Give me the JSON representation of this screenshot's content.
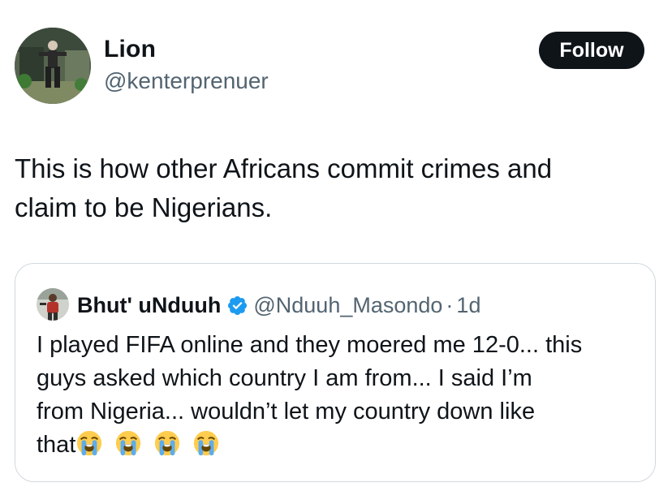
{
  "author": {
    "display_name": "Lion",
    "handle": "@kenterprenuer",
    "avatar_icon": "profile-photo"
  },
  "follow_button": {
    "label": "Follow"
  },
  "tweet": {
    "text_line1": "This is how other Africans commit crimes and",
    "text_line2": "claim to be Nigerians."
  },
  "quoted_tweet": {
    "display_name": "Bhut' uNduuh",
    "verified": true,
    "verified_icon": "verified-badge-icon",
    "handle": "@Nduuh_Masondo",
    "separator": "·",
    "time": "1d",
    "text_line1": "I played FIFA online and they moered me 12-0... this",
    "text_line2": "guys asked which country I am from... I said I’m",
    "text_line3": "from Nigeria... wouldn’t let my country down like",
    "text_line4": "that",
    "emojis": [
      "crying-face",
      "crying-face",
      "crying-face",
      "crying-face"
    ]
  },
  "colors": {
    "text_primary": "#0f1419",
    "text_secondary": "#536471",
    "follow_bg": "#0f1419",
    "verified_blue": "#1d9bf0",
    "card_border": "#cfd9de"
  }
}
